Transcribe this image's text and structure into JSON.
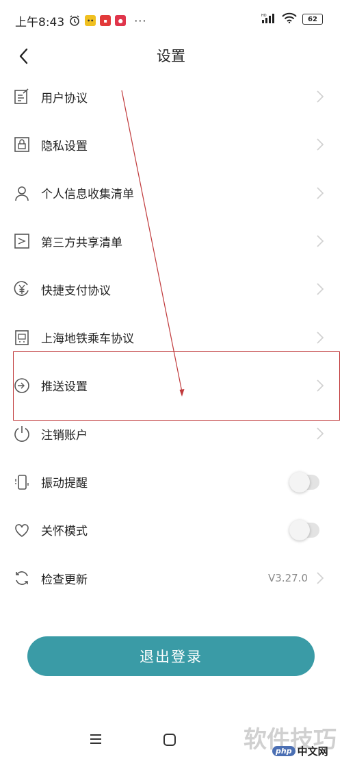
{
  "status_bar": {
    "time": "上午8:43",
    "dots": "···",
    "battery": "62",
    "badge_colors": [
      "#f0c020",
      "#e23a3a",
      "#e0354b"
    ]
  },
  "header": {
    "title": "设置"
  },
  "settings": [
    {
      "label": "用户协议",
      "icon": "document-edit-icon",
      "control": "chevron"
    },
    {
      "label": "隐私设置",
      "icon": "lock-icon",
      "control": "chevron"
    },
    {
      "label": "个人信息收集清单",
      "icon": "person-icon",
      "control": "chevron"
    },
    {
      "label": "第三方共享清单",
      "icon": "share-icon",
      "control": "chevron"
    },
    {
      "label": "快捷支付协议",
      "icon": "yuan-icon",
      "control": "chevron"
    },
    {
      "label": "上海地铁乘车协议",
      "icon": "metro-icon",
      "control": "chevron"
    },
    {
      "label": "推送设置",
      "icon": "push-icon",
      "control": "chevron"
    },
    {
      "label": "注销账户",
      "icon": "power-icon",
      "control": "chevron"
    },
    {
      "label": "振动提醒",
      "icon": "vibrate-icon",
      "control": "toggle",
      "on": false
    },
    {
      "label": "关怀模式",
      "icon": "heart-icon",
      "control": "toggle",
      "on": false
    },
    {
      "label": "检查更新",
      "icon": "refresh-icon",
      "control": "chevron",
      "value": "V3.27.0"
    }
  ],
  "logout": {
    "label": "退出登录",
    "color": "#3a9ba6"
  },
  "annotation": {
    "color": "#c0393b"
  },
  "watermark": {
    "text": "软件技巧",
    "logo_php": "php",
    "logo_cn": "中文网"
  }
}
